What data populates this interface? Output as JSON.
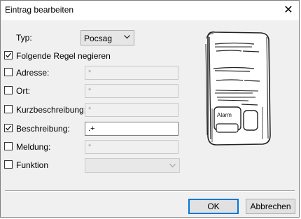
{
  "window": {
    "title": "Eintrag bearbeiten",
    "close_glyph": "✕"
  },
  "typ": {
    "label": "Typ:",
    "value": "Pocsag"
  },
  "negate": {
    "label": "Folgende Regel negieren",
    "checked": true
  },
  "fields": [
    {
      "label": "Adresse:",
      "checked": false,
      "value": "*"
    },
    {
      "label": "Ort:",
      "checked": false,
      "value": "*"
    },
    {
      "label": "Kurzbeschreibung:",
      "checked": false,
      "value": "*"
    },
    {
      "label": "Beschreibung:",
      "checked": true,
      "value": ".+"
    },
    {
      "label": "Meldung:",
      "checked": false,
      "value": "*"
    }
  ],
  "funktion": {
    "label": "Funktion",
    "checked": false,
    "value": ""
  },
  "pager": {
    "button_label": "Alarm"
  },
  "buttons": {
    "ok": "OK",
    "cancel": "Abbrechen"
  },
  "icons": {
    "checkbox_checked": "checkmark-icon",
    "dropdown": "chevron-down-icon",
    "close": "close-icon"
  }
}
